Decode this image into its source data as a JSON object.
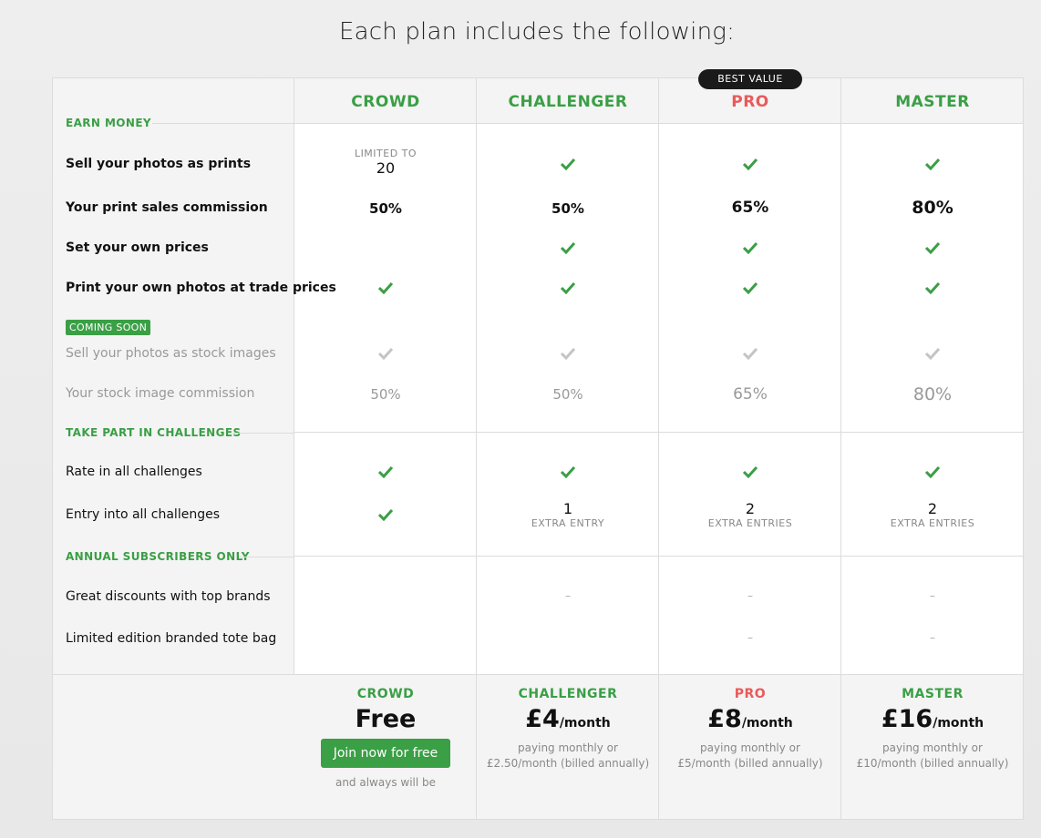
{
  "title": "Each plan includes the following:",
  "best_value": "BEST VALUE",
  "plans": [
    "CROWD",
    "CHALLENGER",
    "PRO",
    "MASTER"
  ],
  "sections": {
    "earn": "EARN MONEY",
    "challenges": "TAKE PART IN CHALLENGES",
    "annual": "ANNUAL SUBSCRIBERS ONLY"
  },
  "coming_soon": "COMING SOON",
  "rows": {
    "sell_prints": "Sell your photos as prints",
    "print_commission": "Your print sales commission",
    "set_prices": "Set your own prices",
    "trade_prices": "Print your own photos at trade prices",
    "stock_images": "Sell your photos as stock images",
    "stock_commission": "Your stock image commission",
    "rate": "Rate in all challenges",
    "entry": "Entry into all challenges",
    "discounts": "Great discounts with top brands",
    "tote": "Limited edition branded tote bag"
  },
  "limited_to": "LIMITED TO",
  "limited_value": "20",
  "print_commission": [
    "50%",
    "50%",
    "65%",
    "80%"
  ],
  "stock_commission": [
    "50%",
    "50%",
    "65%",
    "80%"
  ],
  "entries": [
    {
      "num": "1",
      "label": "EXTRA ENTRY"
    },
    {
      "num": "2",
      "label": "EXTRA ENTRIES"
    },
    {
      "num": "2",
      "label": "EXTRA ENTRIES"
    }
  ],
  "dash": "–",
  "footer": {
    "crowd_price": "Free",
    "join_label": "Join now for free",
    "always": "and always will be",
    "prices": [
      "£4",
      "£8",
      "£16"
    ],
    "per": "/month",
    "paying": "paying monthly or",
    "annual": [
      "£2.50/month (billed annually)",
      "£5/month (billed annually)",
      "£10/month (billed annually)"
    ]
  },
  "colors": {
    "green": "#3a9f45",
    "pro_red": "#ea5a5a",
    "muted_check": "#c4c4c4"
  },
  "icons": {
    "check": "check-icon"
  }
}
